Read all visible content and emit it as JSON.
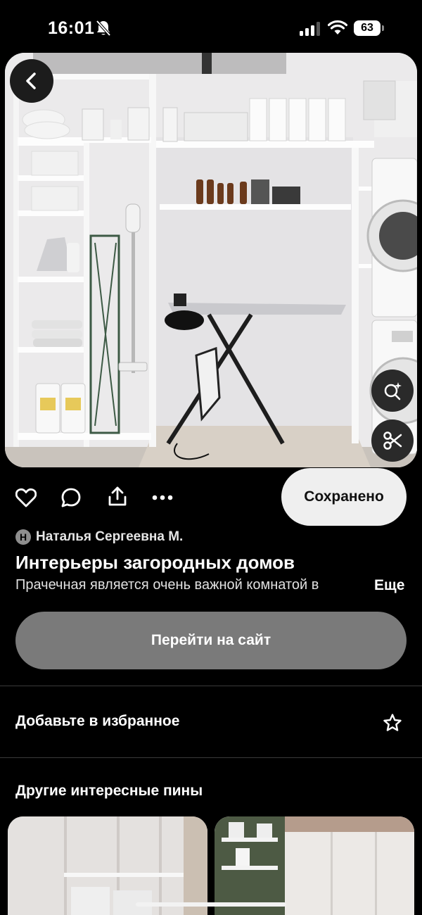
{
  "status_bar": {
    "time": "16:01",
    "battery": "63",
    "icons": [
      "bell-off-icon",
      "signal-icon",
      "wifi-icon",
      "battery-icon"
    ]
  },
  "pin": {
    "image_description_icon": "laundry-room-photo",
    "back_icon": "chevron-left-icon",
    "visual_search_icon": "visual-search-icon",
    "cut_icon": "scissors-icon"
  },
  "actions": {
    "icons": [
      "heart-icon",
      "comment-icon",
      "share-icon",
      "more-icon"
    ],
    "saved_label": "Сохранено"
  },
  "author": {
    "initial": "Н",
    "name": "Наталья Сергеевна М."
  },
  "title": "Интерьеры загородных домов",
  "description": "Прачечная является очень важной комнатой в",
  "more_label": "Еще",
  "visit_label": "Перейти на сайт",
  "favorites_label": "Добавьте в избранное",
  "more_pins_heading": "Другие интересные пины",
  "colors": {
    "background": "#000000",
    "saved_button": "#efefef",
    "visit_button": "#7a7a7a"
  }
}
